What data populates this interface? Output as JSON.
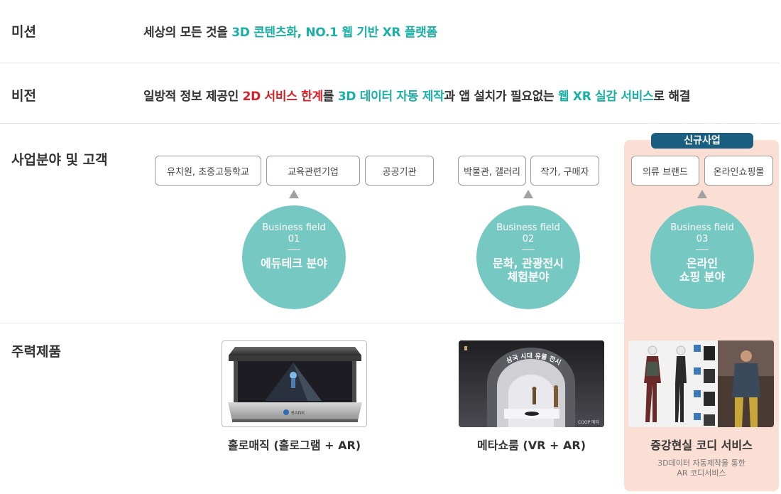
{
  "mission": {
    "label": "미션",
    "parts": [
      {
        "text": "세상의 모든 것을 ",
        "style": "normal"
      },
      {
        "text": "3D 콘텐츠화, NO.1 웹 기반 XR 플랫폼",
        "style": "teal"
      }
    ]
  },
  "vision": {
    "label": "비전",
    "parts": [
      {
        "text": "일방적 정보 제공인 ",
        "style": "normal"
      },
      {
        "text": "2D 서비스 한계",
        "style": "red"
      },
      {
        "text": "를 ",
        "style": "normal"
      },
      {
        "text": "3D 데이터 자동 제작",
        "style": "teal"
      },
      {
        "text": "과 앱 설치가 필요없는 ",
        "style": "normal"
      },
      {
        "text": "웹 XR 실감 서비스",
        "style": "teal"
      },
      {
        "text": "로 해결",
        "style": "normal"
      }
    ]
  },
  "business": {
    "label": "사업분야 및 고객",
    "new_badge": "신규사업",
    "customers": [
      "유치원, 초중고등학교",
      "교육관련기업",
      "공공기관",
      "박물관, 갤러리",
      "작가, 구매자",
      "의류 브랜드",
      "온라인쇼핑몰"
    ],
    "fields": [
      {
        "title": "Business field",
        "number": "01",
        "name": "에듀테크 분야"
      },
      {
        "title": "Business field",
        "number": "02",
        "name": "문화, 관광전시\n체험분야"
      },
      {
        "title": "Business field",
        "number": "03",
        "name": "온라인\n쇼핑 분야"
      }
    ]
  },
  "products": {
    "label": "주력제품",
    "items": [
      {
        "name": "홀로매직 (홀로그램 + AR)",
        "image_logo": "BANK"
      },
      {
        "name": "메타쇼룸 (VR + AR)",
        "image_banner": "삼국 시대 유물 전시관",
        "image_corner": "COOP 메타"
      },
      {
        "name": "증강현실 코디 서비스",
        "note": "3D데이터 자동제작을 통한\nAR 코디서비스"
      }
    ]
  },
  "colors": {
    "teal": "#1bb0a6",
    "red": "#d81f26",
    "circle": "#76c8c2",
    "badge": "#1a5f80",
    "highlight": "#fbdfd4"
  }
}
